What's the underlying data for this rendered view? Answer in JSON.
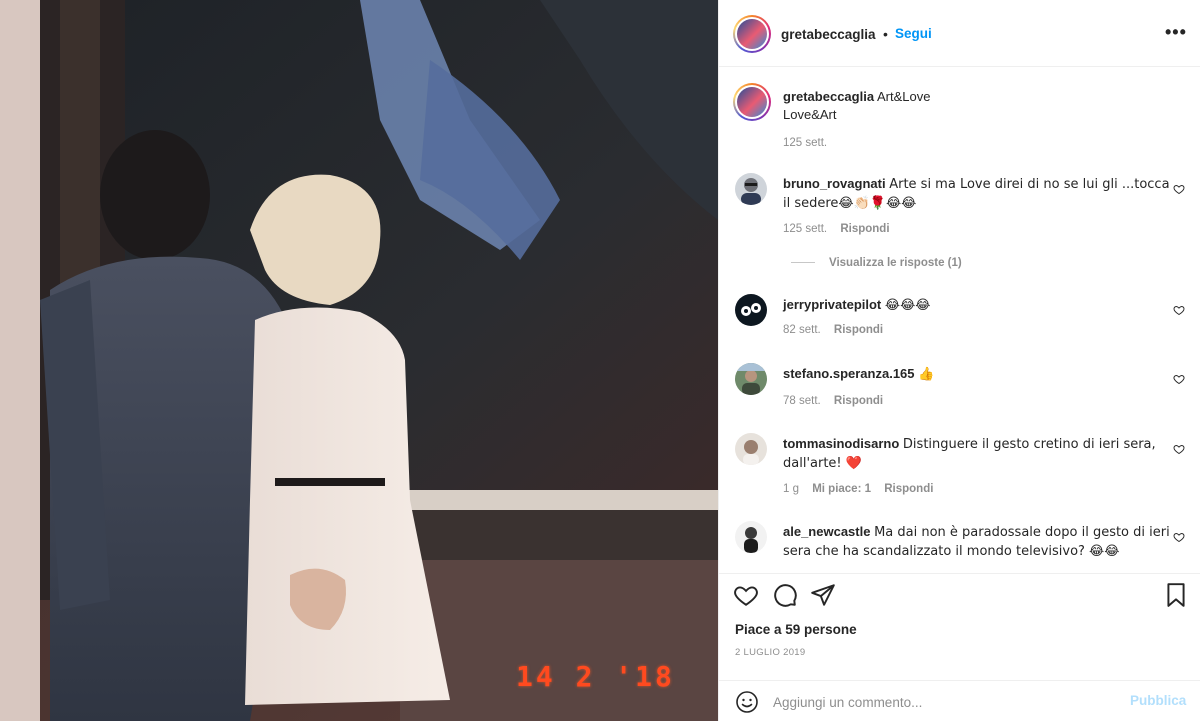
{
  "post": {
    "photo": {
      "date_stamp": "14 2 '18"
    },
    "header": {
      "username": "gretabeccaglia",
      "separator": "•",
      "follow_label": "Segui",
      "more_icon": "more-horizontal-icon"
    },
    "caption": {
      "username": "gretabeccaglia",
      "line1": "Art&Love",
      "line2": "Love&Art",
      "time": "125 sett."
    },
    "comments": [
      {
        "username": "bruno_rovagnati",
        "text": "Arte si ma Love direi di no se lui gli ...tocca il sedere😂👏🏻🌹😂😂",
        "time": "125 sett.",
        "likes": "",
        "reply_label": "Rispondi",
        "view_replies": "Visualizza le risposte (1)"
      },
      {
        "username": "jerryprivatepilot",
        "text": "😂😂😂",
        "time": "82 sett.",
        "likes": "",
        "reply_label": "Rispondi"
      },
      {
        "username": "stefano.speranza.165",
        "text": "👍",
        "time": "78 sett.",
        "likes": "",
        "reply_label": "Rispondi"
      },
      {
        "username": "tommasinodisarno",
        "text": "Distinguere il gesto cretino di ieri sera, dall'arte! ❤️",
        "time": "1 g",
        "likes": "Mi piace: 1",
        "reply_label": "Rispondi"
      },
      {
        "username": "ale_newcastle",
        "text": "Ma dai non è paradossale dopo il gesto di ieri sera che ha scandalizzato il mondo televisivo? 😂😂",
        "time": "",
        "likes": "",
        "reply_label": ""
      }
    ],
    "actions": {
      "icons": [
        "heart-icon",
        "comment-icon",
        "share-icon",
        "bookmark-icon"
      ],
      "likes_text": "Piace a 59 persone",
      "date": "2 LUGLIO 2019"
    },
    "add_comment": {
      "placeholder": "Aggiungi un commento...",
      "publish_label": "Pubblica",
      "emoji_icon": "emoji-icon"
    }
  },
  "colors": {
    "follow_blue": "#0095f6",
    "publish_disabled": "#b2dffc",
    "muted_text": "#8e8e8e",
    "date_stamp": "#ff4a1f"
  }
}
